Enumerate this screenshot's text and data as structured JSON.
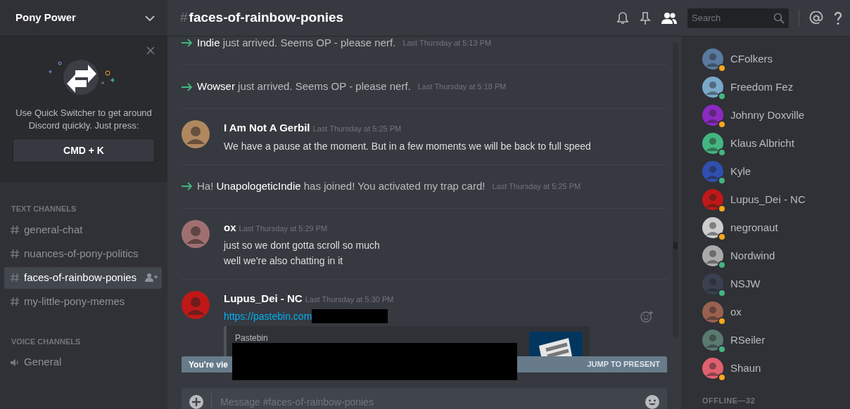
{
  "server": {
    "name": "Pony Power"
  },
  "quick_switcher": {
    "text": "Use Quick Switcher to get around Discord quickly. Just press:",
    "shortcut": "CMD + K"
  },
  "categories": [
    {
      "name": "TEXT CHANNELS",
      "channels": [
        {
          "name": "general-chat",
          "kind": "text",
          "selected": false
        },
        {
          "name": "nuances-of-pony-politics",
          "kind": "text",
          "selected": false
        },
        {
          "name": "faces-of-rainbow-ponies",
          "kind": "text",
          "selected": true
        },
        {
          "name": "my-little-pony-memes",
          "kind": "text",
          "selected": false
        }
      ]
    },
    {
      "name": "VOICE CHANNELS",
      "channels": [
        {
          "name": "General",
          "kind": "voice",
          "selected": false
        }
      ]
    }
  ],
  "channel_header": {
    "hash": "#",
    "name": "faces-of-rainbow-ponies"
  },
  "search": {
    "placeholder": "Search"
  },
  "messages": [
    {
      "kind": "join",
      "user": "Indie",
      "text": "just arrived. Seems OP - please nerf.",
      "time": "Last Thursday at 5:13 PM"
    },
    {
      "kind": "join",
      "user": "Wowser",
      "text": "just arrived. Seems OP - please nerf.",
      "time": "Last Thursday at 5:18 PM"
    },
    {
      "kind": "message",
      "author": "I Am Not A Gerbil",
      "time": "Last Thursday at 5:25 PM",
      "lines": [
        "We have a pause at the moment. But in a few moments we will be back to full speed"
      ]
    },
    {
      "kind": "join",
      "prefix": "Ha!",
      "user": "UnapologeticIndie",
      "text": "has joined! You activated my trap card!",
      "time": "Last Thursday at 5:25 PM"
    },
    {
      "kind": "message",
      "author": "ox",
      "time": "Last Thursday at 5:29 PM",
      "lines": [
        "just so we dont gotta scroll so much",
        "well we're also chatting in it"
      ]
    },
    {
      "kind": "message",
      "author": "Lupus_Dei - NC",
      "time": "Last Thursday at 5:30 PM",
      "link": "https://pastebin.com",
      "embed": {
        "provider": "Pastebin"
      }
    }
  ],
  "banner": {
    "text": "You're vie",
    "action": "JUMP TO PRESENT"
  },
  "composer": {
    "placeholder": "Message #faces-of-rainbow-ponies"
  },
  "members": [
    {
      "name": "CFolkers",
      "color": "#faa61a"
    },
    {
      "name": "Freedom Fez",
      "color": "#43b581"
    },
    {
      "name": "Johnny Doxville",
      "color": "#faa61a"
    },
    {
      "name": "Klaus Albricht",
      "color": "#43b581"
    },
    {
      "name": "Kyle",
      "color": "#43b581"
    },
    {
      "name": "Lupus_Dei - NC",
      "color": "#faa61a"
    },
    {
      "name": "negronaut",
      "color": "#faa61a"
    },
    {
      "name": "Nordwind",
      "color": "#43b581"
    },
    {
      "name": "NSJW",
      "color": "#43b581"
    },
    {
      "name": "ox",
      "color": "#faa61a"
    },
    {
      "name": "RSeiler",
      "color": "#43b581"
    },
    {
      "name": "Shaun",
      "color": "#faa61a"
    }
  ],
  "offline_header": "OFFLINE—32"
}
